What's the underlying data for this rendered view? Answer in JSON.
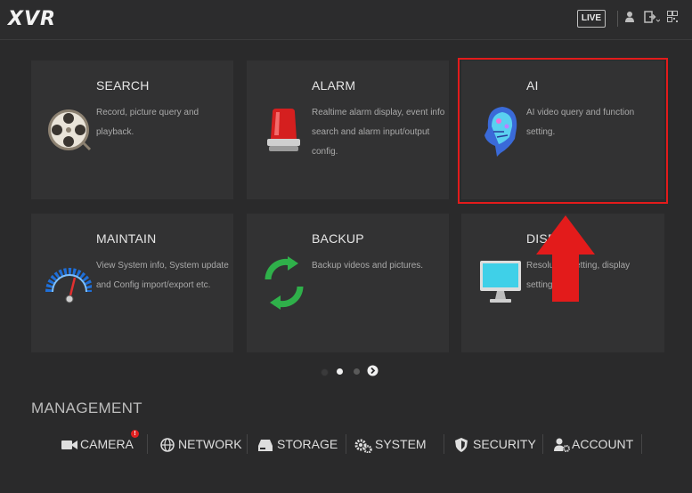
{
  "header": {
    "logo": "XVR",
    "live_label": "LIVE",
    "icons": [
      "user-icon",
      "logout-icon",
      "qr-code-icon"
    ]
  },
  "tiles": [
    {
      "title": "SEARCH",
      "desc": "Record, picture query and playback.",
      "icon": "film-reel-icon"
    },
    {
      "title": "ALARM",
      "desc": "Realtime alarm display, event info search and alarm input/output config.",
      "icon": "alarm-light-icon"
    },
    {
      "title": "AI",
      "desc": "AI video query and function setting.",
      "icon": "ai-head-icon"
    },
    {
      "title": "MAINTAIN",
      "desc": "View System info, System update and Config import/export etc.",
      "icon": "gauge-icon"
    },
    {
      "title": "BACKUP",
      "desc": "Backup videos and pictures.",
      "icon": "sync-arrows-icon"
    },
    {
      "title": "DISPLAY",
      "desc": "Resolution setting, display setting.",
      "icon": "monitor-icon"
    }
  ],
  "annotation": {
    "highlight_color": "#e31b1b",
    "arrow_color": "#e31b1b"
  },
  "pager": {
    "pages": 3,
    "current_page": 2
  },
  "management": {
    "title": "MANAGEMENT",
    "items": [
      {
        "label": "CAMERA",
        "icon": "camera-icon",
        "badge": "!"
      },
      {
        "label": "NETWORK",
        "icon": "globe-icon"
      },
      {
        "label": "STORAGE",
        "icon": "hard-drive-icon"
      },
      {
        "label": "SYSTEM",
        "icon": "gears-icon"
      },
      {
        "label": "SECURITY",
        "icon": "shield-icon"
      },
      {
        "label": "ACCOUNT",
        "icon": "user-settings-icon"
      }
    ]
  }
}
